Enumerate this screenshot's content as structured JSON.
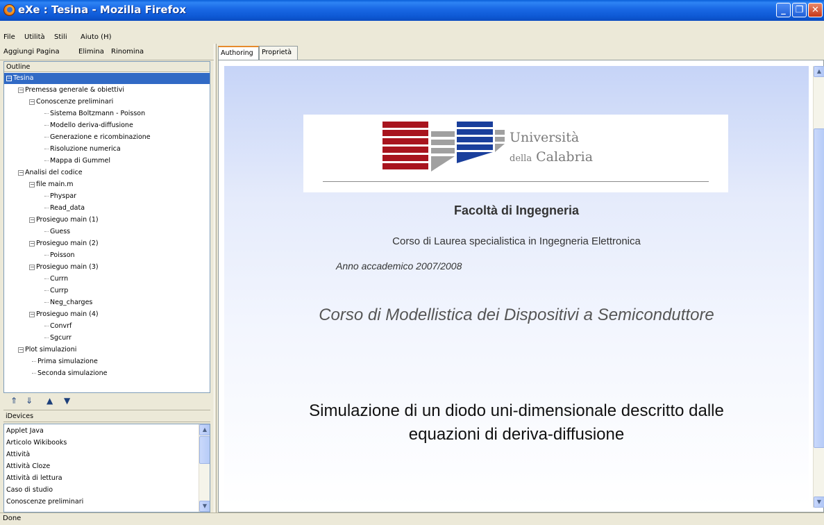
{
  "window": {
    "title": "eXe : Tesina - Mozilla Firefox"
  },
  "menu": {
    "file": "File",
    "utility": "Utilità",
    "styles": "Stili",
    "help": "Aiuto (H)"
  },
  "outline_toolbar": {
    "add_page": "Aggiungi Pagina",
    "delete": "Elimina",
    "rename": "Rinomina"
  },
  "outline": {
    "header": "Outline",
    "items": [
      {
        "label": "Tesina"
      },
      {
        "label": "Premessa generale & obiettivi"
      },
      {
        "label": "Conoscenze preliminari"
      },
      {
        "label": "Sistema Boltzmann -  Poisson"
      },
      {
        "label": "Modello deriva-diffusione"
      },
      {
        "label": "Generazione e ricombinazione"
      },
      {
        "label": "Risoluzione numerica"
      },
      {
        "label": "Mappa di Gummel"
      },
      {
        "label": "Analisi del codice"
      },
      {
        "label": "file main.m"
      },
      {
        "label": "Physpar"
      },
      {
        "label": "Read_data"
      },
      {
        "label": "Prosieguo main (1)"
      },
      {
        "label": "Guess"
      },
      {
        "label": "Prosieguo main (2)"
      },
      {
        "label": "Poisson"
      },
      {
        "label": "Prosieguo main (3)"
      },
      {
        "label": "Currn"
      },
      {
        "label": "Currp"
      },
      {
        "label": "Neg_charges"
      },
      {
        "label": "Prosieguo main (4)"
      },
      {
        "label": "Convrf"
      },
      {
        "label": "Sgcurr"
      },
      {
        "label": "Plot simulazioni"
      },
      {
        "label": "Prima simulazione"
      },
      {
        "label": "Seconda simulazione"
      }
    ]
  },
  "idevices": {
    "label": "iDevices",
    "items": [
      "Applet Java",
      "Articolo Wikibooks",
      "Attività",
      "Attività Cloze",
      "Attività  di lettura",
      "Caso di studio",
      "Conoscenze preliminari"
    ]
  },
  "tabs": {
    "authoring": "Authoring",
    "properties": "Proprietà"
  },
  "content": {
    "logo_line1": "Università",
    "logo_della": "della",
    "logo_calabria": "Calabria",
    "faculty": "Facoltà di Ingegneria",
    "degree": "Corso di Laurea specialistica in Ingegneria Elettronica",
    "academic_year": "Anno accademico 2007/2008",
    "course": "Corso di Modellistica dei Dispositivi a Semiconduttore",
    "title_line1": "Simulazione di un diodo uni-dimensionale descritto dalle",
    "title_line2": "equazioni di deriva-diffusione"
  },
  "status": {
    "text": "Done"
  },
  "colors": {
    "titlebar": "#0b5ad6",
    "selection": "#316ac5",
    "logo_red": "#a8141e",
    "logo_blue": "#1a3f9c",
    "logo_gray": "#a0a0a0"
  }
}
